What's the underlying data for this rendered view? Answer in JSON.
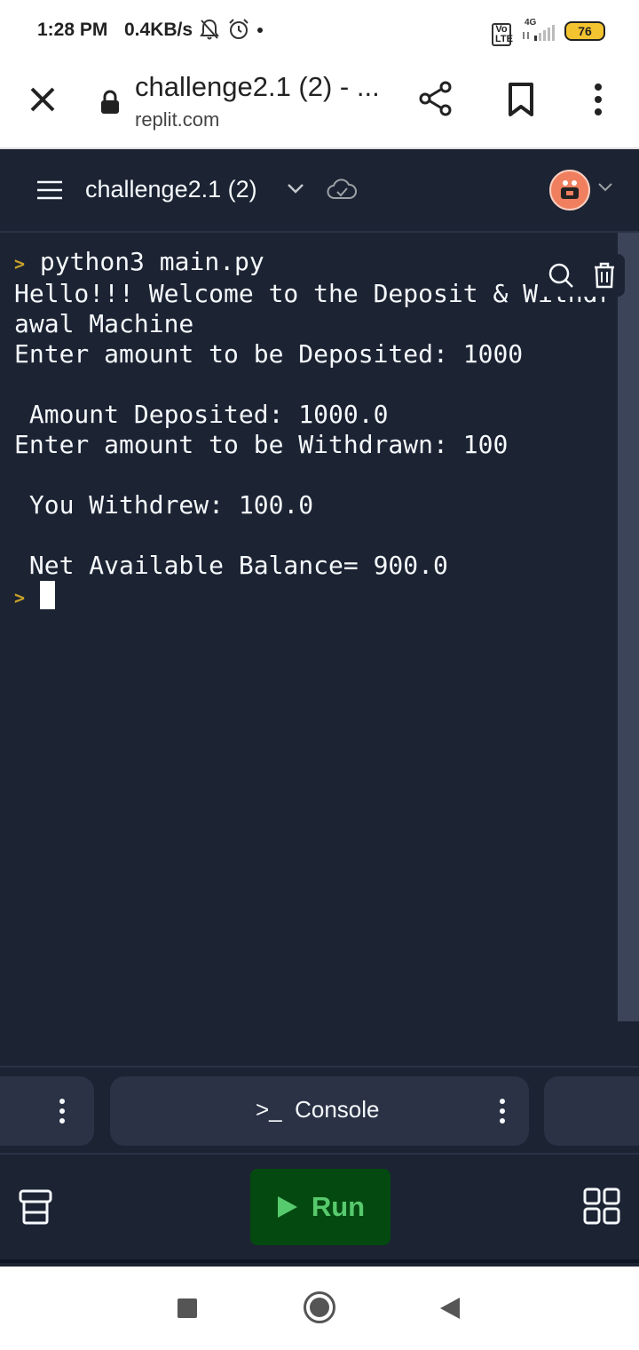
{
  "status_bar": {
    "time": "1:28 PM",
    "speed": "0.4KB/s",
    "network": "4G",
    "volte": "Vo LTE",
    "battery": "76"
  },
  "browser": {
    "page_title": "challenge2.1 (2) - ...",
    "url": "replit.com"
  },
  "replit_header": {
    "repl_name": "challenge2.1 (2)"
  },
  "console": {
    "command": "python3 main.py",
    "output_lines": [
      "Hello!!! Welcome to the Deposit & Withdr",
      "awal Machine",
      "Enter amount to be Deposited: 1000",
      "",
      " Amount Deposited: 1000.0",
      "Enter amount to be Withdrawn: 100",
      "",
      " You Withdrew: 100.0",
      "",
      " Net Available Balance= 900.0"
    ]
  },
  "tabs": {
    "console_label": "Console",
    "console_prefix": ">_"
  },
  "actions": {
    "run_label": "Run"
  },
  "colors": {
    "background": "#1c2333",
    "run_button_bg": "#044a10",
    "run_text": "#58ca6e",
    "prompt": "#c9a227",
    "avatar": "#ef7f5f"
  }
}
